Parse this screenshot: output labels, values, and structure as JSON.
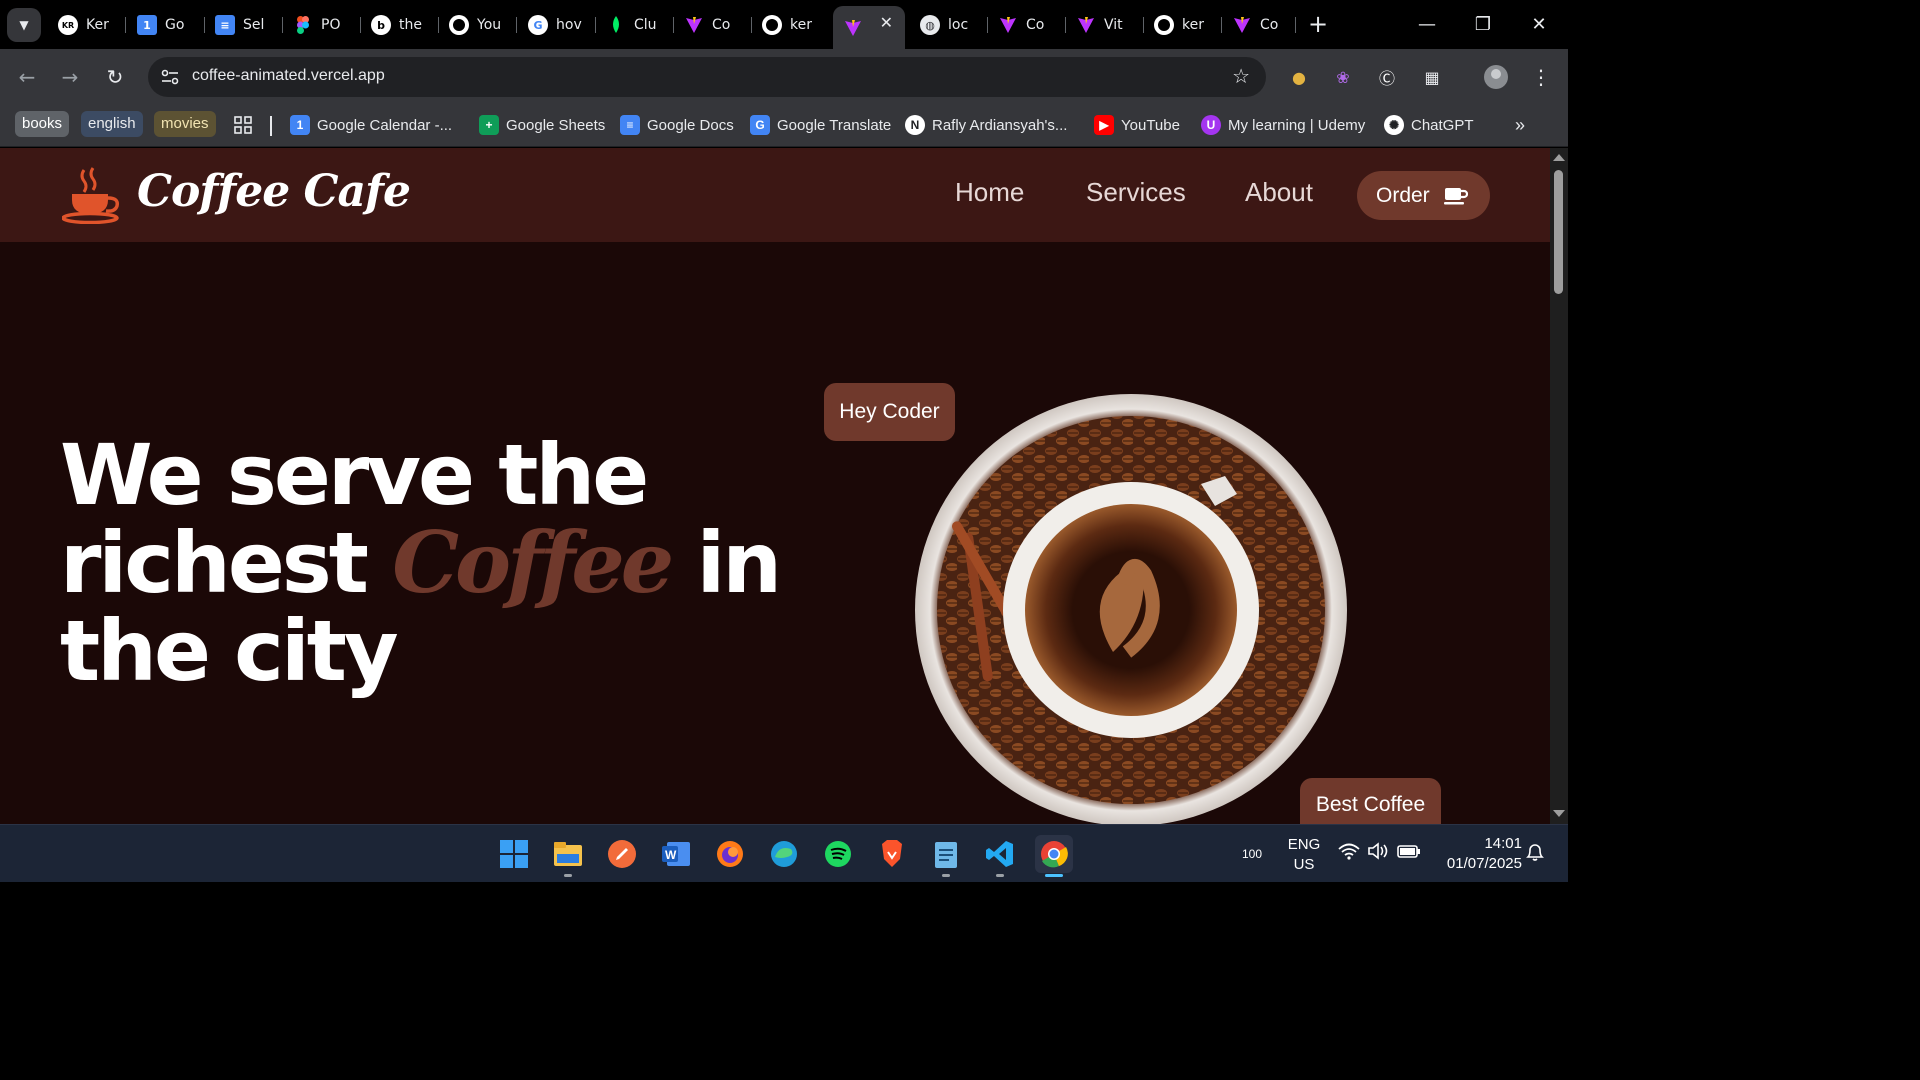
{
  "browser": {
    "tabs": [
      {
        "label": "Ker",
        "icon": "kr-avatar-icon",
        "color": "#ffffff"
      },
      {
        "label": "Go",
        "icon": "google-calendar-icon",
        "color": "#4285f4"
      },
      {
        "label": "Sel",
        "icon": "google-docs-icon",
        "color": "#4285f4"
      },
      {
        "label": "PO",
        "icon": "figma-icon",
        "color": "#f24e1e"
      },
      {
        "label": "the",
        "icon": "bing-icon",
        "color": "#ffffff"
      },
      {
        "label": "You",
        "icon": "github-icon",
        "color": "#ffffff"
      },
      {
        "label": "hov",
        "icon": "google-icon",
        "color": "#ffffff"
      },
      {
        "label": "Clu",
        "icon": "mongodb-icon",
        "color": "#00ed64"
      },
      {
        "label": "Co",
        "icon": "vite-icon",
        "color": "#bd34fe"
      },
      {
        "label": "ker",
        "icon": "github-icon",
        "color": "#ffffff"
      },
      {
        "label": "",
        "icon": "vite-icon",
        "color": "#bd34fe",
        "active": true
      },
      {
        "label": "loc",
        "icon": "globe-icon",
        "color": "#e8eaed"
      },
      {
        "label": "Co",
        "icon": "vite-icon",
        "color": "#bd34fe"
      },
      {
        "label": "Vit",
        "icon": "vite-icon",
        "color": "#bd34fe"
      },
      {
        "label": "ker",
        "icon": "github-icon",
        "color": "#ffffff"
      },
      {
        "label": "Co",
        "icon": "vite-icon",
        "color": "#bd34fe"
      }
    ],
    "new_tab": "+",
    "url": "coffee-animated.vercel.app",
    "bookmark_chips": [
      {
        "label": "books",
        "bg": "#5f6368",
        "fg": "#ffffff"
      },
      {
        "label": "english",
        "bg": "#3c4b63",
        "fg": "#e8eaed"
      },
      {
        "label": "movies",
        "bg": "#5c5233",
        "fg": "#f1e3b1"
      }
    ],
    "bookmarks": [
      {
        "label": "Google Calendar -...",
        "icon": "google-calendar-icon",
        "color": "#4285f4",
        "glyph": "1"
      },
      {
        "label": "Google Sheets",
        "icon": "google-sheets-icon",
        "color": "#0f9d58",
        "glyph": "+"
      },
      {
        "label": "Google Docs",
        "icon": "google-docs-icon",
        "color": "#4285f4",
        "glyph": "≡"
      },
      {
        "label": "Google Translate",
        "icon": "google-translate-icon",
        "color": "#4285f4",
        "glyph": "G"
      },
      {
        "label": "Rafly Ardiansyah's...",
        "icon": "notion-icon",
        "color": "#ffffff",
        "glyph": "N"
      },
      {
        "label": "YouTube",
        "icon": "youtube-icon",
        "color": "#ff0000",
        "glyph": "▶"
      },
      {
        "label": "My learning | Udemy",
        "icon": "udemy-icon",
        "color": "#a435f0",
        "glyph": "U"
      },
      {
        "label": "ChatGPT",
        "icon": "chatgpt-icon",
        "color": "#ffffff",
        "glyph": "✺"
      }
    ],
    "more": "»"
  },
  "site": {
    "logo_text": "Coffee Cafe",
    "nav": [
      "Home",
      "Services",
      "About"
    ],
    "order_label": "Order",
    "hero": {
      "line1": "We serve the",
      "line2_pre": "richest ",
      "line2_accent": "Coffee",
      "line2_post": " in",
      "line3": "the city"
    },
    "badge_top": "Hey Coder",
    "badge_bottom": "Best Coffee"
  },
  "colors": {
    "page_bg": "#1b0807",
    "nav_bg": "#3c1714",
    "accent": "#70392c",
    "logo_orange": "#e0542b"
  },
  "taskbar": {
    "apps": [
      "windows-start-icon",
      "file-explorer-icon",
      "pencil-app-icon",
      "word-icon",
      "firefox-icon",
      "edge-icon",
      "spotify-icon",
      "brave-icon",
      "notepad-icon",
      "vscode-icon",
      "chrome-icon"
    ],
    "battery": "100",
    "lang_line1": "ENG",
    "lang_line2": "US",
    "time": "14:01",
    "date": "01/07/2025"
  }
}
